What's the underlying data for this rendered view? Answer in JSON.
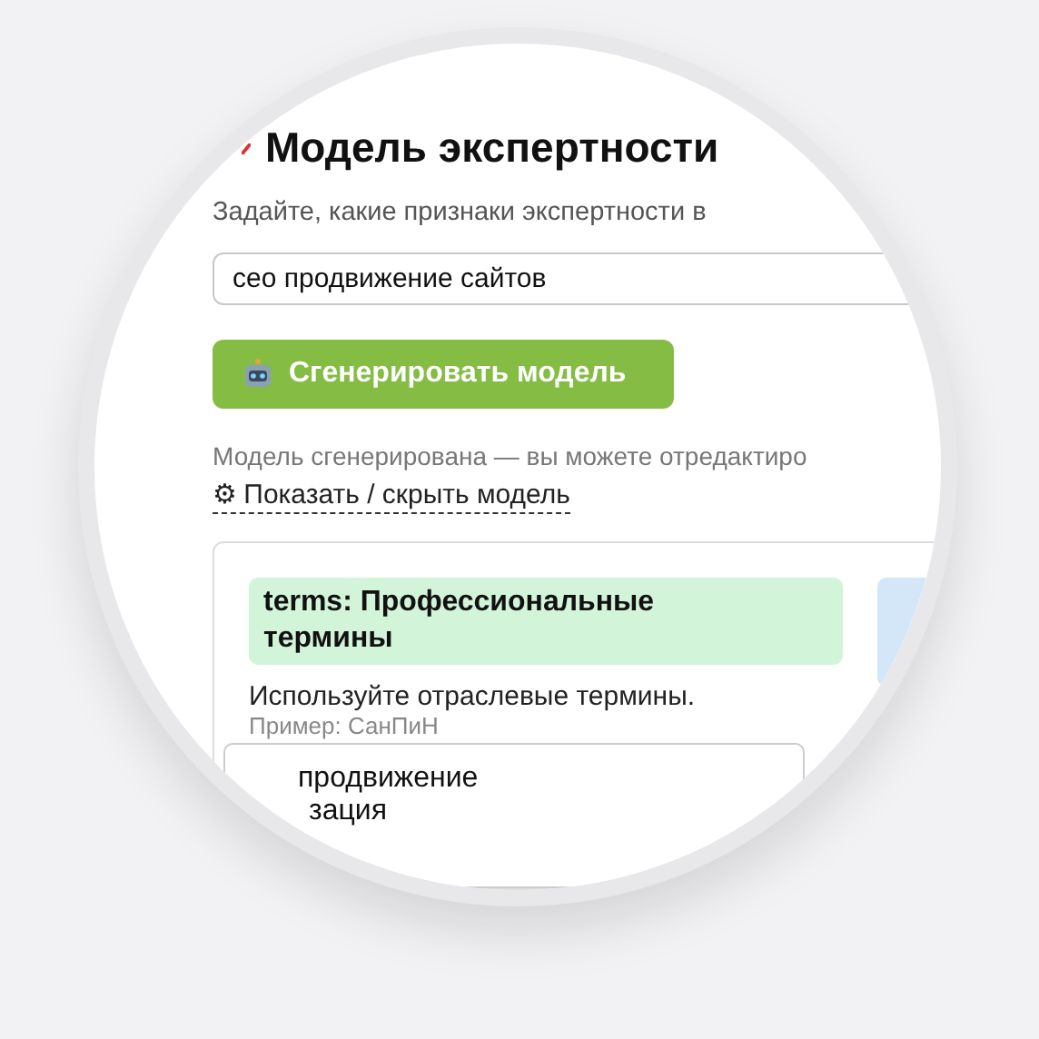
{
  "title": "Модель экспертности",
  "subtitle": "Задайте, какие признаки экспертности в",
  "topic_field": {
    "value": "сео продвижение сайтов"
  },
  "generate_button": {
    "label": "Сгенерировать модель"
  },
  "status": "Модель сгенерирована — вы можете отредактиро",
  "toggle_link": "⚙ Показать / скрыть модель",
  "model_card": {
    "items": [
      {
        "header": "terms: Профессиональные термины",
        "description": "Используйте отраслевые термины.",
        "example": "Пример: СанПиН",
        "keywords": [
          "продвижение",
          "зация"
        ]
      }
    ]
  }
}
